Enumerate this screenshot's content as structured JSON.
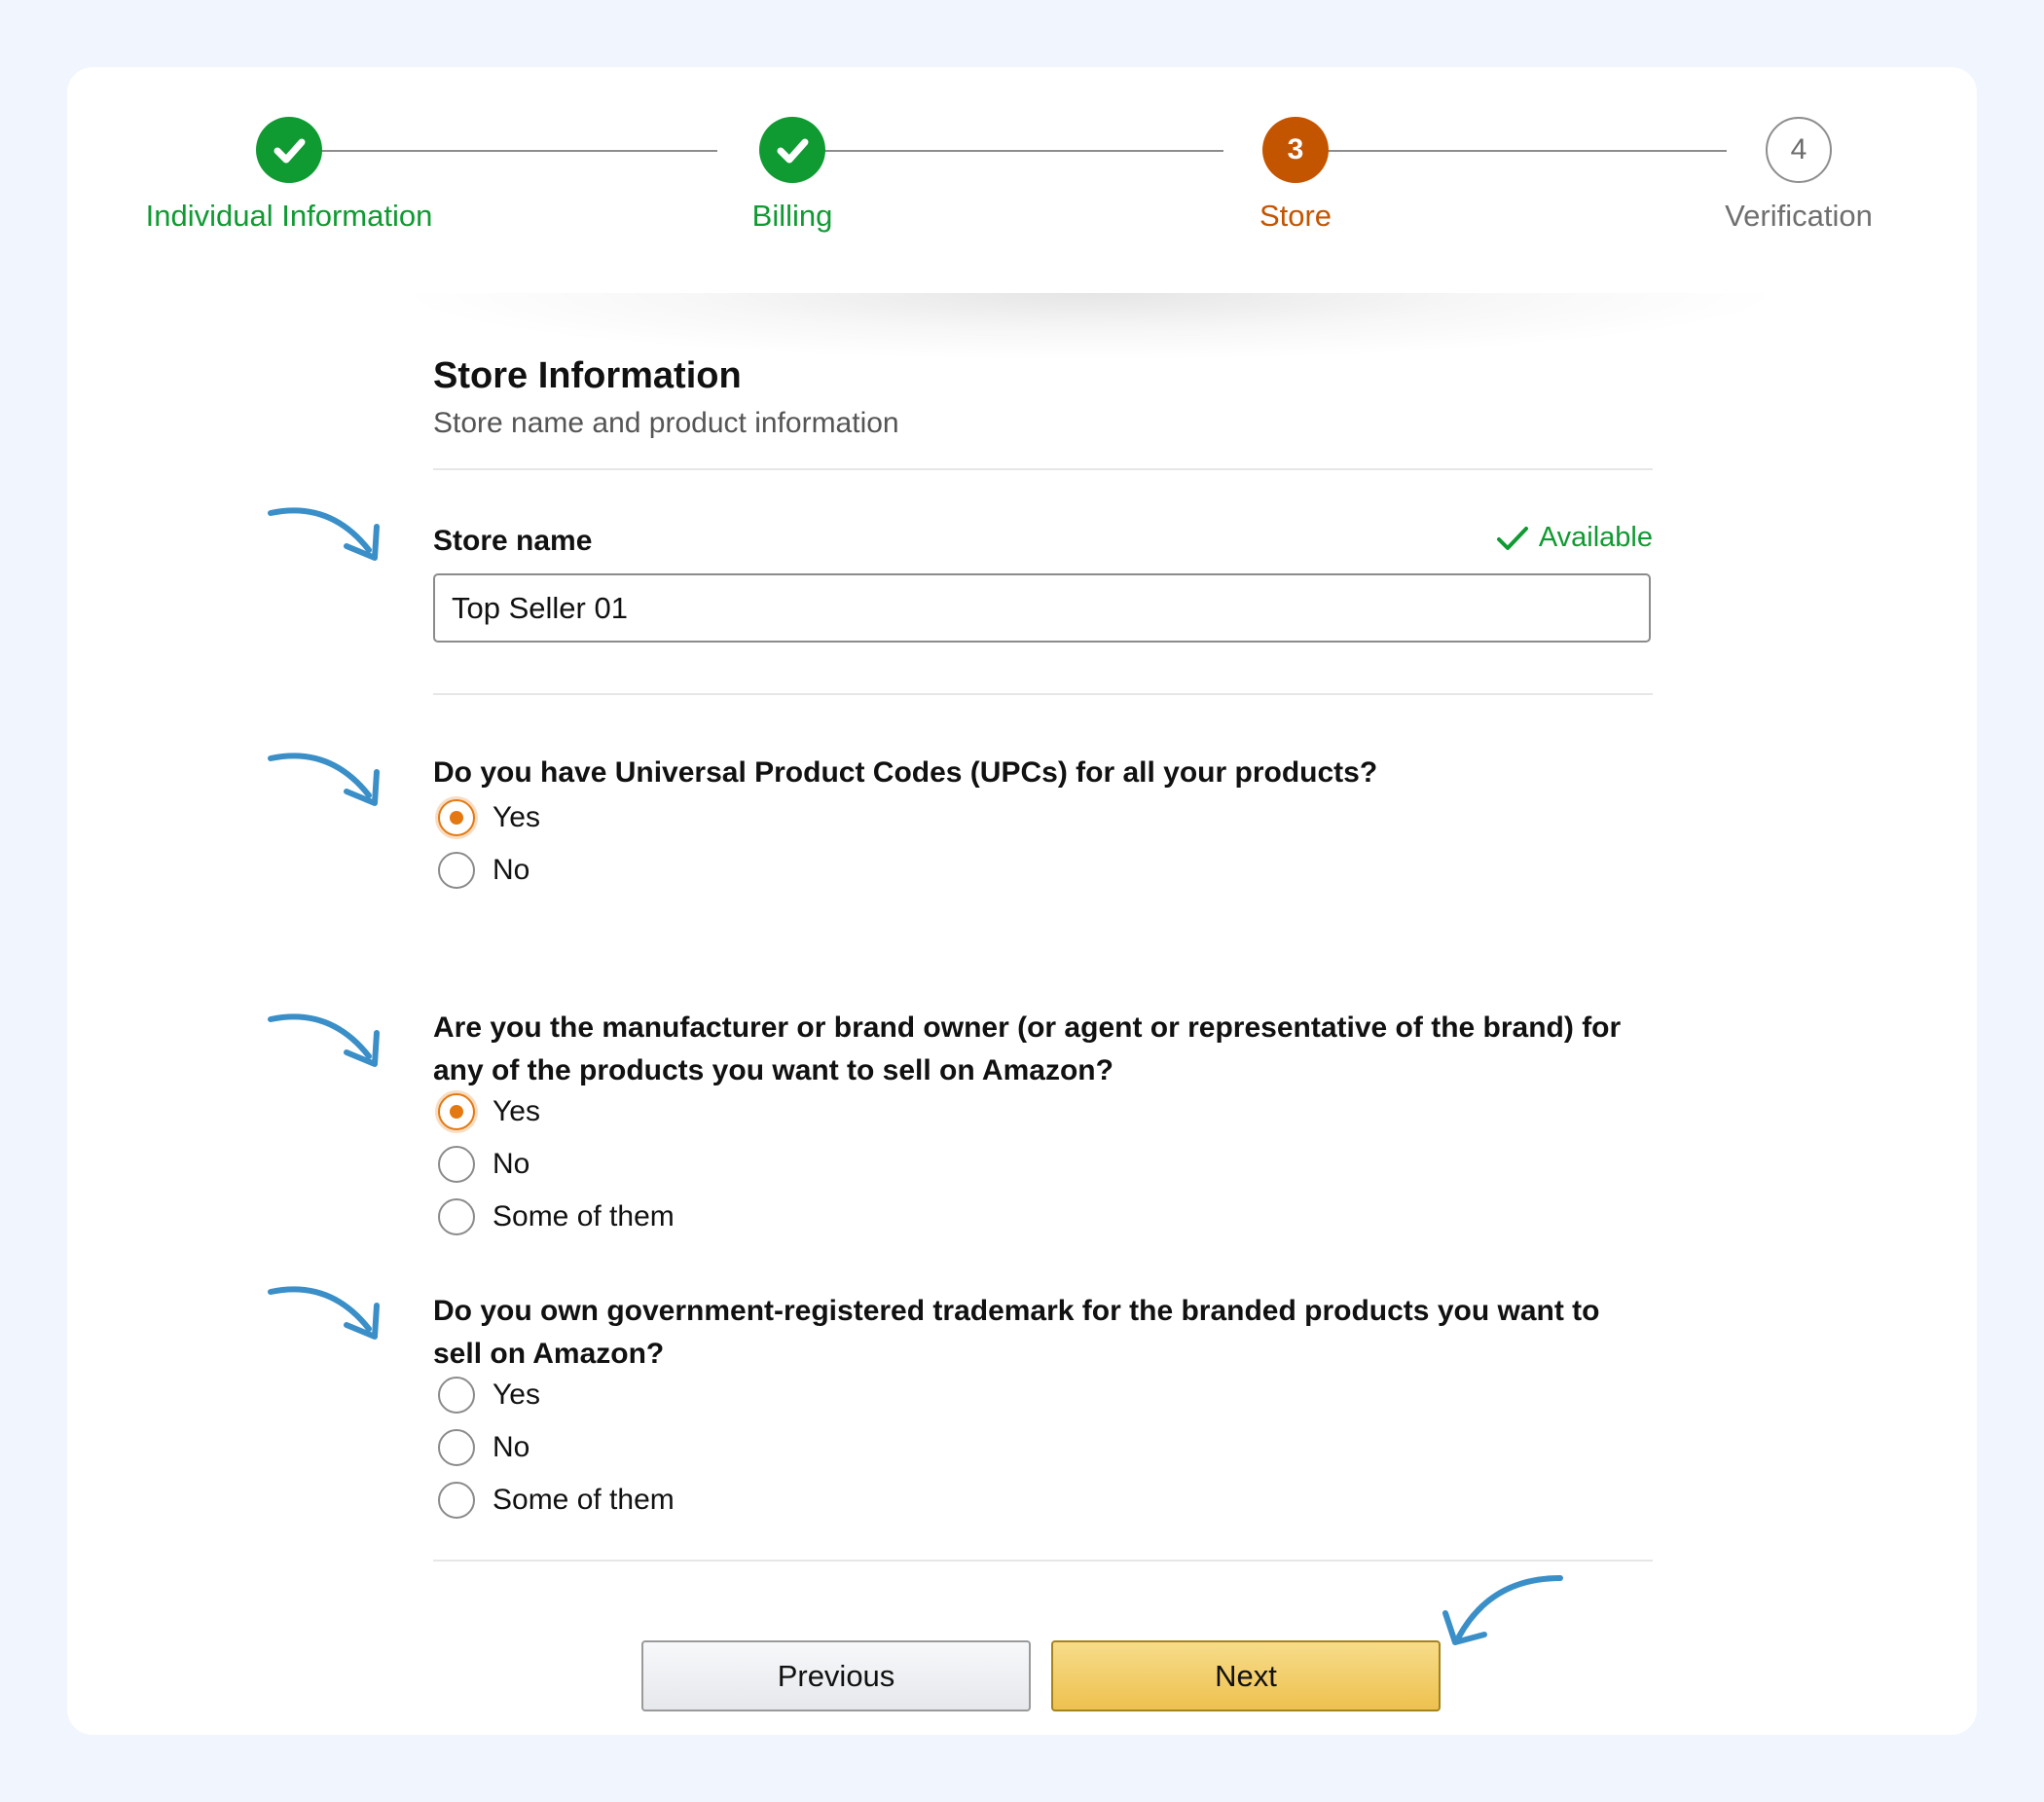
{
  "stepper": {
    "steps": [
      {
        "number": "1",
        "label": "Individual Information",
        "state": "done"
      },
      {
        "number": "2",
        "label": "Billing",
        "state": "done"
      },
      {
        "number": "3",
        "label": "Store",
        "state": "current"
      },
      {
        "number": "4",
        "label": "Verification",
        "state": "future"
      }
    ]
  },
  "section": {
    "title": "Store Information",
    "subtitle": "Store name and product information"
  },
  "store_name": {
    "label": "Store name",
    "availability": "Available",
    "value": "Top Seller 01"
  },
  "questions": [
    {
      "text": "Do you have Universal Product Codes (UPCs) for all your products?",
      "options": [
        "Yes",
        "No"
      ],
      "selected": "Yes"
    },
    {
      "text": "Are you the manufacturer or brand owner (or agent or representative of the brand) for any of the products you want to sell on Amazon?",
      "options": [
        "Yes",
        "No",
        "Some of them"
      ],
      "selected": "Yes"
    },
    {
      "text": "Do you own government-registered trademark for the branded products you want to sell on Amazon?",
      "options": [
        "Yes",
        "No",
        "Some of them"
      ],
      "selected": null
    }
  ],
  "buttons": {
    "previous": "Previous",
    "next": "Next"
  },
  "colors": {
    "done": "#0f9a32",
    "current": "#c45500",
    "radio_selected": "#e47911",
    "arrow": "#3a8fc8",
    "next_button": "#f0c14b"
  },
  "icons": {
    "done_step": "checkmark-icon",
    "available": "checkmark-icon",
    "annotation": "curved-arrow-icon"
  }
}
